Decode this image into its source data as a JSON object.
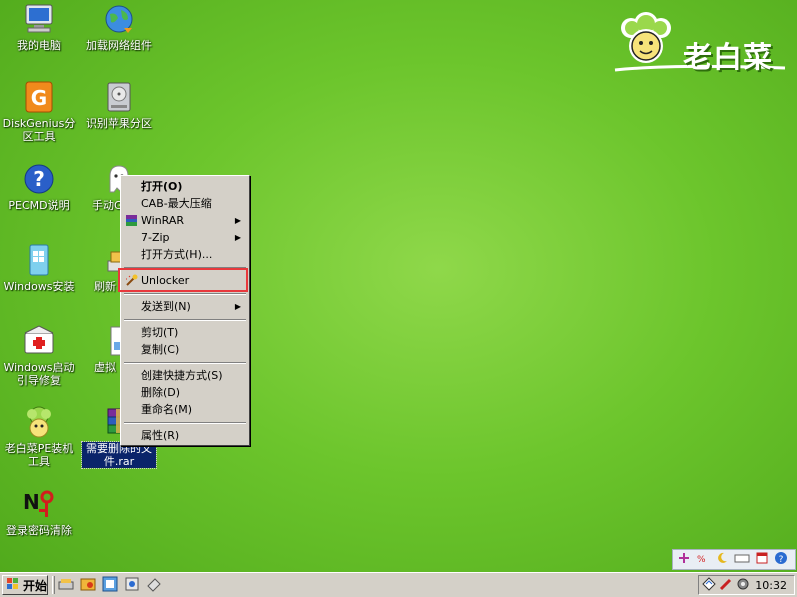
{
  "desktop": {
    "icons": [
      {
        "label": "我的电脑",
        "icon": "computer-icon"
      },
      {
        "label": "加载网络组件",
        "icon": "network-globe-icon"
      },
      {
        "label": "DiskGenius分区工具",
        "icon": "diskgenius-icon"
      },
      {
        "label": "识别苹果分区",
        "icon": "hard-drive-icon"
      },
      {
        "label": "PECMD说明",
        "icon": "help-icon"
      },
      {
        "label": "手动G",
        "icon": "ghost-icon"
      },
      {
        "label": "Windows安装",
        "icon": "windows-install-icon"
      },
      {
        "label": "刷新",
        "icon": "refresh-icon"
      },
      {
        "label": "Windows启动引导修复",
        "icon": "repair-kit-icon"
      },
      {
        "label": "虚拟",
        "icon": "virtual-icon"
      },
      {
        "label": "老白菜PE装机工具",
        "icon": "laobaicai-tool-icon"
      },
      {
        "label": "需要删除的文件.rar",
        "icon": "rar-archive-icon"
      },
      {
        "label": "登录密码清除",
        "icon": "password-clear-icon"
      }
    ]
  },
  "logo": {
    "text": "老白菜"
  },
  "context_menu": {
    "items": [
      {
        "label": "打开(O)",
        "bold": true
      },
      {
        "label": "CAB-最大压缩"
      },
      {
        "label": "WinRAR",
        "submenu": true
      },
      {
        "label": "7-Zip",
        "submenu": true
      },
      {
        "label": "打开方式(H)..."
      },
      {
        "label": "Unlocker"
      },
      {
        "label": "发送到(N)",
        "submenu": true
      },
      {
        "label": "剪切(T)"
      },
      {
        "label": "复制(C)"
      },
      {
        "label": "创建快捷方式(S)"
      },
      {
        "label": "删除(D)"
      },
      {
        "label": "重命名(M)"
      },
      {
        "label": "属性(R)"
      }
    ],
    "highlight_color": "#e8383c"
  },
  "taskbar": {
    "start_label": "开始",
    "clock": "10:32"
  },
  "colors": {
    "desktop_green": "#6cc52c",
    "menu_bg": "#d4d0c8",
    "selection": "#0a246a"
  }
}
